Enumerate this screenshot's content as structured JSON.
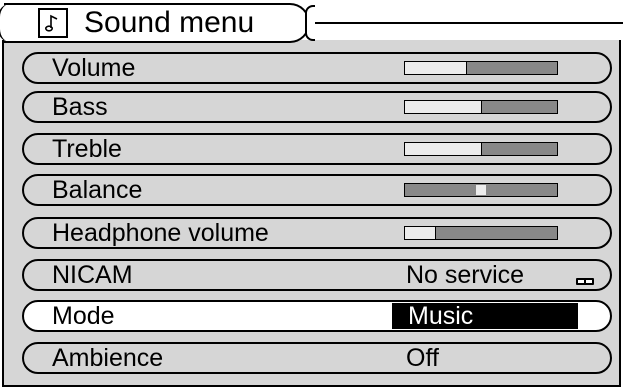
{
  "menu": {
    "title": "Sound menu",
    "title_icon": "music-note-icon",
    "items": [
      {
        "label": "Volume",
        "type": "slider",
        "level": 0.4
      },
      {
        "label": "Bass",
        "type": "slider",
        "level": 0.5
      },
      {
        "label": "Treble",
        "type": "slider",
        "level": 0.5
      },
      {
        "label": "Balance",
        "type": "balance",
        "level": 0.5
      },
      {
        "label": "Headphone volume",
        "type": "slider",
        "level": 0.2
      },
      {
        "label": "NICAM",
        "type": "text",
        "value": "No service",
        "icon": "stereo-indicator-icon"
      },
      {
        "label": "Mode",
        "type": "text",
        "value": "Music",
        "selected": true
      },
      {
        "label": "Ambience",
        "type": "text",
        "value": "Off"
      }
    ]
  },
  "colors": {
    "row_background": "#d6d6d6",
    "selected_row_background": "#ffffff",
    "selected_value_background": "#000000",
    "slider_track": "#888888",
    "slider_fill": "#ececec"
  }
}
